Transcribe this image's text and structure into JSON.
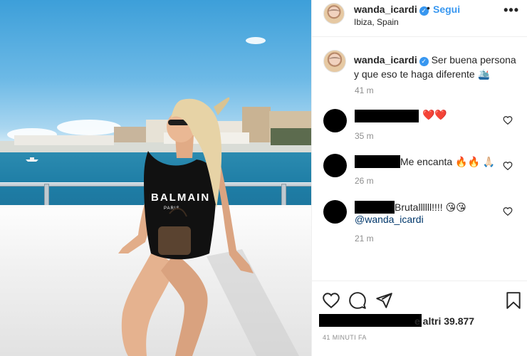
{
  "post": {
    "photo_description": "",
    "author": {
      "username": "wanda_icardi",
      "verified_icon": "verified-badge-icon",
      "follow_separator": "•",
      "follow_label": "Segui",
      "location": "Ibiza, Spain",
      "more_icon": "more-options-icon",
      "more_label": "•••"
    },
    "caption": {
      "username": "wanda_icardi",
      "text": "Ser buena persona y que eso te haga diferente 🛳️",
      "time": "41 m"
    },
    "comments": [
      {
        "text": "❤️❤️",
        "time": "35 m",
        "mention": ""
      },
      {
        "text": "Me encanta 🔥🔥 🙏🏻",
        "time": "26 m",
        "mention": ""
      },
      {
        "text": "Brutallllll!!!! 😘😘",
        "time": "21 m",
        "mention": "@wanda_icardi"
      }
    ],
    "actions": {
      "like_icon": "heart-icon",
      "comment_icon": "comment-bubble-icon",
      "share_icon": "paper-plane-icon",
      "save_icon": "bookmark-icon"
    },
    "likes_text": "e altri 39.877",
    "posted_ago": "41 MINUTI FA"
  },
  "colors": {
    "accent_link": "#3897f0",
    "mention": "#00376b",
    "muted_text": "#8e8e8e",
    "primary_text": "#262626",
    "heart_emoji": "#e0245e"
  }
}
